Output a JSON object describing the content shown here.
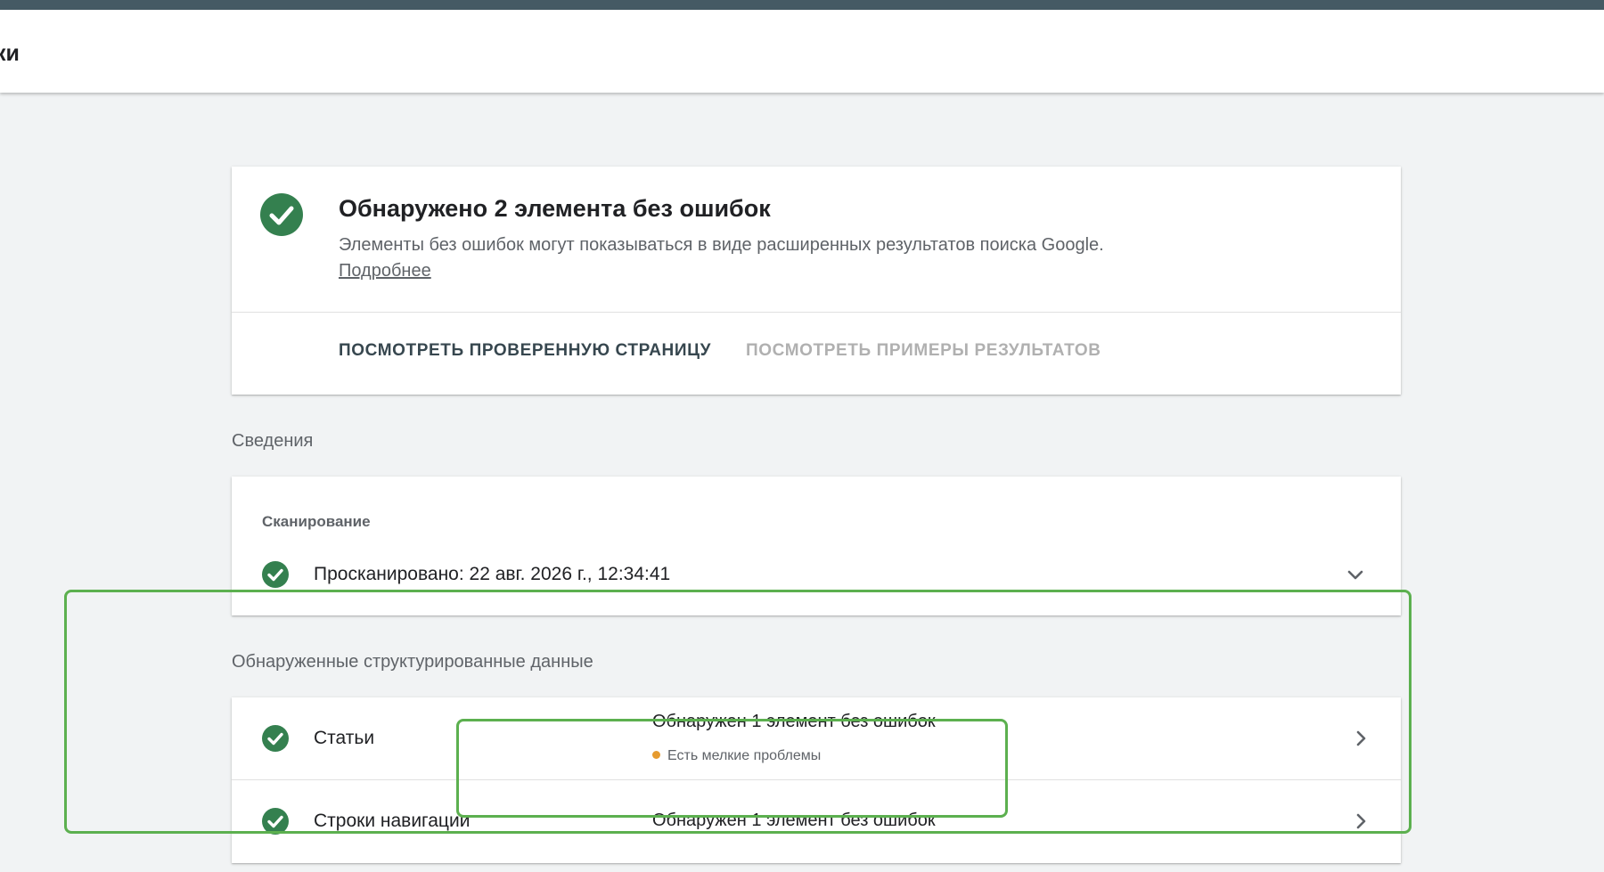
{
  "header": {
    "title": "ки"
  },
  "summary": {
    "title": "Обнаружено 2 элемента без ошибок",
    "description": "Элементы без ошибок могут показываться в виде расширенных результатов поиска Google.",
    "learn_more": "Подробнее",
    "view_tested_page": "ПОСМОТРЕТЬ ПРОВЕРЕННУЮ СТРАНИЦУ",
    "view_search_results": "ПОСМОТРЕТЬ ПРИМЕРЫ РЕЗУЛЬТАТОВ"
  },
  "details": {
    "section_title": "Сведения",
    "crawl_label": "Сканирование",
    "crawl_value": "Просканировано: 22 авг. 2026 г., 12:34:41"
  },
  "structured": {
    "section_title": "Обнаруженные структурированные данные",
    "items": [
      {
        "name": "Статьи",
        "status": "Обнаружен 1 элемент без ошибок",
        "note": "Есть мелкие проблемы"
      },
      {
        "name": "Строки навигации",
        "status": "Обнаружен 1 элемент без ошибок"
      }
    ]
  },
  "colors": {
    "success": "#34804f",
    "warning": "#e69b2f",
    "highlight": "#5cb04f",
    "top_bar": "#455a64"
  }
}
